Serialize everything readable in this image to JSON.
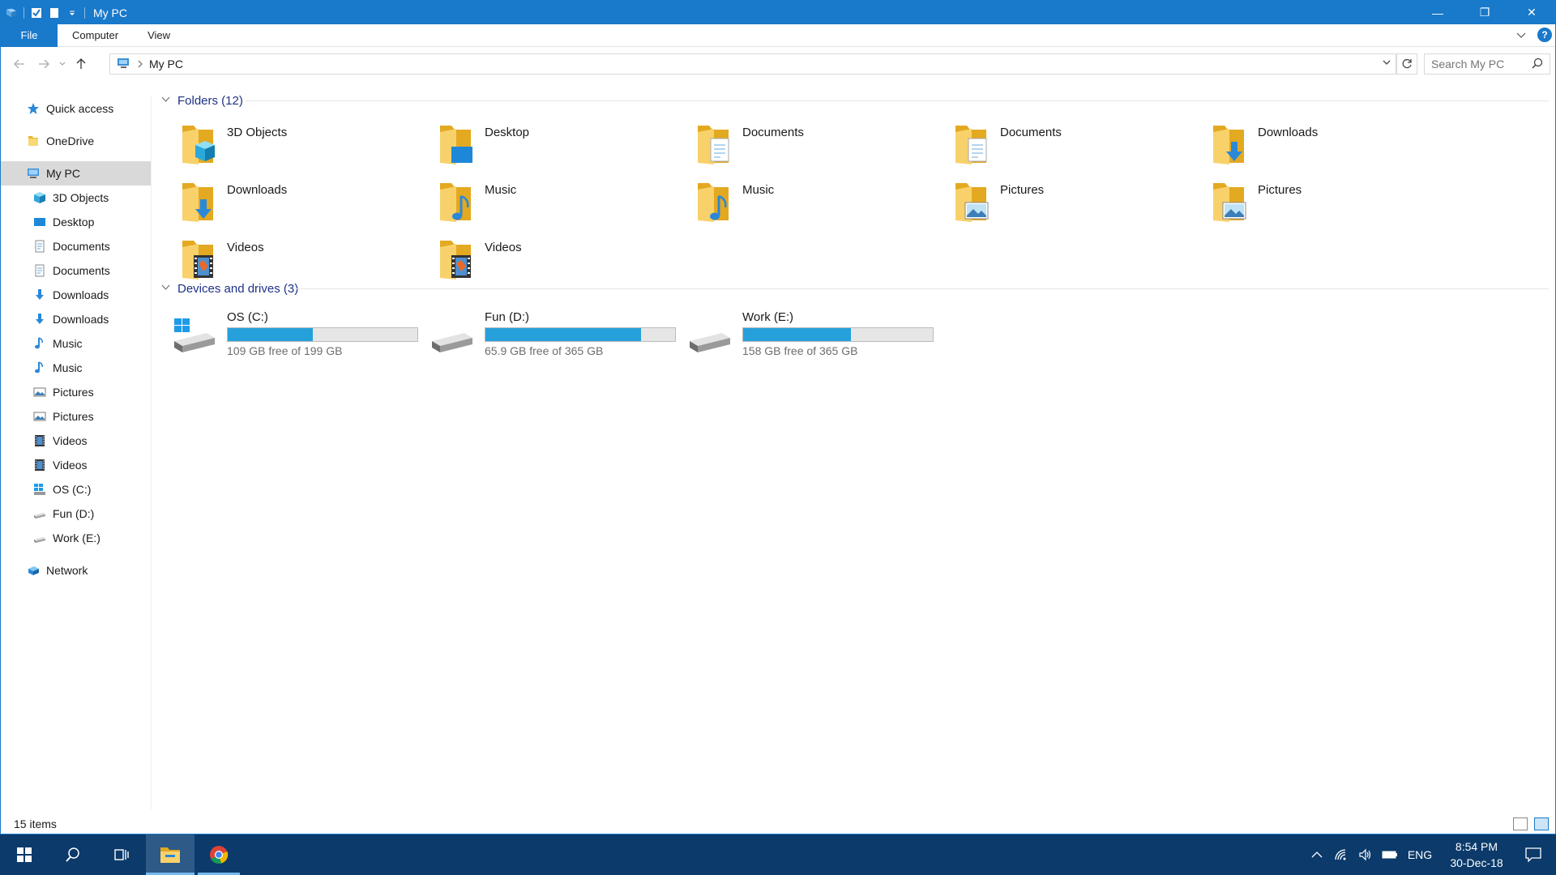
{
  "window": {
    "title": "My PC",
    "accent_color": "#1979ca",
    "controls": {
      "minimize": "—",
      "restore": "❐",
      "close": "✕"
    }
  },
  "ribbon": {
    "tabs": [
      {
        "label": "File",
        "active": true
      },
      {
        "label": "Computer"
      },
      {
        "label": "View"
      }
    ],
    "help": "?"
  },
  "address": {
    "path": [
      "My PC"
    ],
    "search_placeholder": "Search My PC"
  },
  "sidebar": {
    "items": [
      {
        "label": "Quick access",
        "icon": "star-icon",
        "level": 1
      },
      {
        "label": "OneDrive",
        "icon": "onedrive-icon",
        "level": 1
      },
      {
        "label": "My PC",
        "icon": "computer-icon",
        "level": 1,
        "selected": true
      },
      {
        "label": "3D Objects",
        "icon": "3d-objects-icon",
        "level": 2
      },
      {
        "label": "Desktop",
        "icon": "desktop-icon",
        "level": 2
      },
      {
        "label": "Documents",
        "icon": "documents-icon",
        "level": 2
      },
      {
        "label": "Documents",
        "icon": "documents-icon",
        "level": 2
      },
      {
        "label": "Downloads",
        "icon": "downloads-icon",
        "level": 2
      },
      {
        "label": "Downloads",
        "icon": "downloads-icon",
        "level": 2
      },
      {
        "label": "Music",
        "icon": "music-icon",
        "level": 2
      },
      {
        "label": "Music",
        "icon": "music-icon",
        "level": 2
      },
      {
        "label": "Pictures",
        "icon": "pictures-icon",
        "level": 2
      },
      {
        "label": "Pictures",
        "icon": "pictures-icon",
        "level": 2
      },
      {
        "label": "Videos",
        "icon": "videos-icon",
        "level": 2
      },
      {
        "label": "Videos",
        "icon": "videos-icon",
        "level": 2
      },
      {
        "label": "OS (C:)",
        "icon": "windows-drive-icon",
        "level": 2
      },
      {
        "label": "Fun (D:)",
        "icon": "drive-icon",
        "level": 2
      },
      {
        "label": "Work (E:)",
        "icon": "drive-icon",
        "level": 2
      },
      {
        "label": "Network",
        "icon": "network-icon",
        "level": 1
      }
    ]
  },
  "content": {
    "folders_header": "Folders (12)",
    "folders": [
      {
        "name": "3D Objects",
        "icon": "3d-objects-folder-icon"
      },
      {
        "name": "Desktop",
        "icon": "desktop-folder-icon"
      },
      {
        "name": "Documents",
        "icon": "documents-folder-icon"
      },
      {
        "name": "Documents",
        "icon": "documents-folder-icon"
      },
      {
        "name": "Downloads",
        "icon": "downloads-folder-icon"
      },
      {
        "name": "Downloads",
        "icon": "downloads-folder-icon"
      },
      {
        "name": "Music",
        "icon": "music-folder-icon"
      },
      {
        "name": "Music",
        "icon": "music-folder-icon"
      },
      {
        "name": "Pictures",
        "icon": "pictures-folder-icon"
      },
      {
        "name": "Pictures",
        "icon": "pictures-folder-icon"
      },
      {
        "name": "Videos",
        "icon": "videos-folder-icon"
      },
      {
        "name": "Videos",
        "icon": "videos-folder-icon"
      }
    ],
    "drives_header": "Devices and drives (3)",
    "drives": [
      {
        "name": "OS (C:)",
        "free_text": "109 GB free of 199 GB",
        "used_fraction": 0.45,
        "icon": "windows-drive-icon"
      },
      {
        "name": "Fun (D:)",
        "free_text": "65.9 GB free of 365 GB",
        "used_fraction": 0.82,
        "icon": "drive-icon"
      },
      {
        "name": "Work (E:)",
        "free_text": "158 GB free of 365 GB",
        "used_fraction": 0.57,
        "icon": "drive-icon"
      }
    ]
  },
  "status": {
    "items_count": "15 items"
  },
  "taskbar": {
    "apps": [
      "start-icon",
      "search-icon",
      "task-view-icon",
      "file-explorer-icon",
      "chrome-icon"
    ],
    "language": "ENG",
    "time": "8:54 PM",
    "date": "30-Dec-18"
  }
}
